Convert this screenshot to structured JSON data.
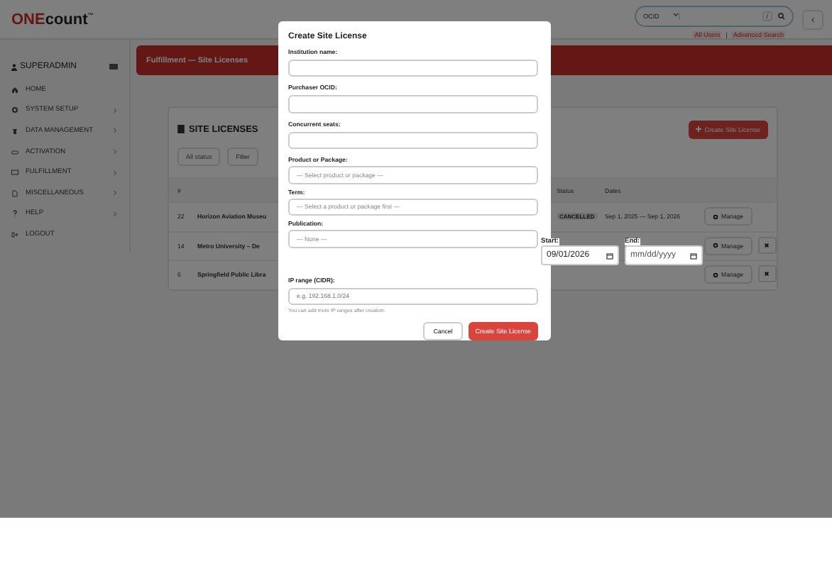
{
  "header": {
    "logo_accent": "ONE",
    "logo_rest": "count",
    "logo_mark": "™",
    "search_scope": "OCID",
    "shortcut": "/",
    "links": [
      "All Users",
      "Advanced Search"
    ],
    "link_separator": "|",
    "collapse": "‹"
  },
  "sidebar": {
    "user": "SUPERADMIN",
    "items": [
      {
        "label": "HOME",
        "submenu": false
      },
      {
        "label": "SYSTEM SETUP",
        "submenu": true
      },
      {
        "label": "DATA MANAGEMENT",
        "submenu": true
      },
      {
        "label": "ACTIVATION",
        "submenu": true
      },
      {
        "label": "FULFILLMENT",
        "submenu": true
      },
      {
        "label": "MISCELLANEOUS",
        "submenu": true
      },
      {
        "label": "HELP",
        "submenu": true
      },
      {
        "label": "LOGOUT",
        "submenu": false
      }
    ]
  },
  "banner": "Fulfillment — Site Licenses",
  "card": {
    "title": "SITE LICENSES",
    "create_button": "Create Site License",
    "status_filter": "All status",
    "filter_button": "Filter",
    "columns": [
      "#",
      "Status",
      "Dates"
    ],
    "rows": [
      {
        "id": "22",
        "name": "Horizon Aviation Museu",
        "status": "CANCELLED",
        "dates": "Sep 1, 2025 — Sep 1, 2026",
        "manage": "Manage",
        "deletable": false
      },
      {
        "id": "14",
        "name": "Metro University – De",
        "manage": "Manage",
        "deletable": true
      },
      {
        "id": "6",
        "name": "Springfield Public Libra",
        "manage": "Manage",
        "deletable": true
      }
    ]
  },
  "modal": {
    "title": "Create Site License",
    "fields": [
      {
        "kind": "input",
        "label": "Institution name:"
      },
      {
        "kind": "input",
        "label": "Purchaser OCID:"
      },
      {
        "kind": "input",
        "label": "Concurrent seats:"
      },
      {
        "kind": "select",
        "label": "Product or Package:",
        "placeholder": "— Select product or package —"
      },
      {
        "kind": "select",
        "label": "Term:",
        "placeholder": "— Select a product or package first —"
      },
      {
        "kind": "select",
        "label": "Publication:",
        "placeholder": "— None —"
      },
      {
        "kind": "spacer"
      },
      {
        "kind": "input",
        "label": "IP range (CIDR):",
        "placeholder": "e.g. 192.168.1.0/24",
        "hint": "You can add more IP ranges after creation."
      }
    ],
    "start": {
      "label": "Start:",
      "value": "09/01/2026"
    },
    "end": {
      "label": "End:",
      "placeholder": "mm/dd/yyyy"
    },
    "cancel": "Cancel",
    "submit": "Create Site License"
  }
}
